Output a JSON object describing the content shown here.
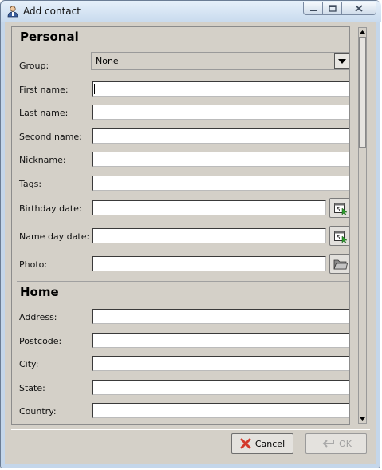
{
  "window": {
    "title": "Add contact",
    "icon": "user-contact-icon",
    "controls": [
      "minimize-icon",
      "maximize-icon",
      "close-icon"
    ]
  },
  "personal": {
    "title": "Personal",
    "group_label": "Group:",
    "group_value": "None",
    "first_name_label": "First name:",
    "last_name_label": "Last name:",
    "second_name_label": "Second name:",
    "nickname_label": "Nickname:",
    "tags_label": "Tags:",
    "birthday_label": "Birthday date:",
    "name_day_label": "Name day date:",
    "photo_label": "Photo:",
    "calendar_icon": "calendar-icon",
    "folder_icon": "folder-icon"
  },
  "home": {
    "title": "Home",
    "address_label": "Address:",
    "postcode_label": "Postcode:",
    "city_label": "City:",
    "state_label": "State:",
    "country_label": "Country:"
  },
  "footer": {
    "cancel_label": "Cancel",
    "cancel_icon": "cancel-x-icon",
    "ok_label": "OK",
    "ok_icon": "ok-arrow-icon",
    "ok_enabled": false
  },
  "colors": {
    "dialog_bg": "#d4d0c8",
    "titlebar": "#c9dbee",
    "cancel_icon": "#d33a2c",
    "disabled_text": "#a0a0a0"
  }
}
